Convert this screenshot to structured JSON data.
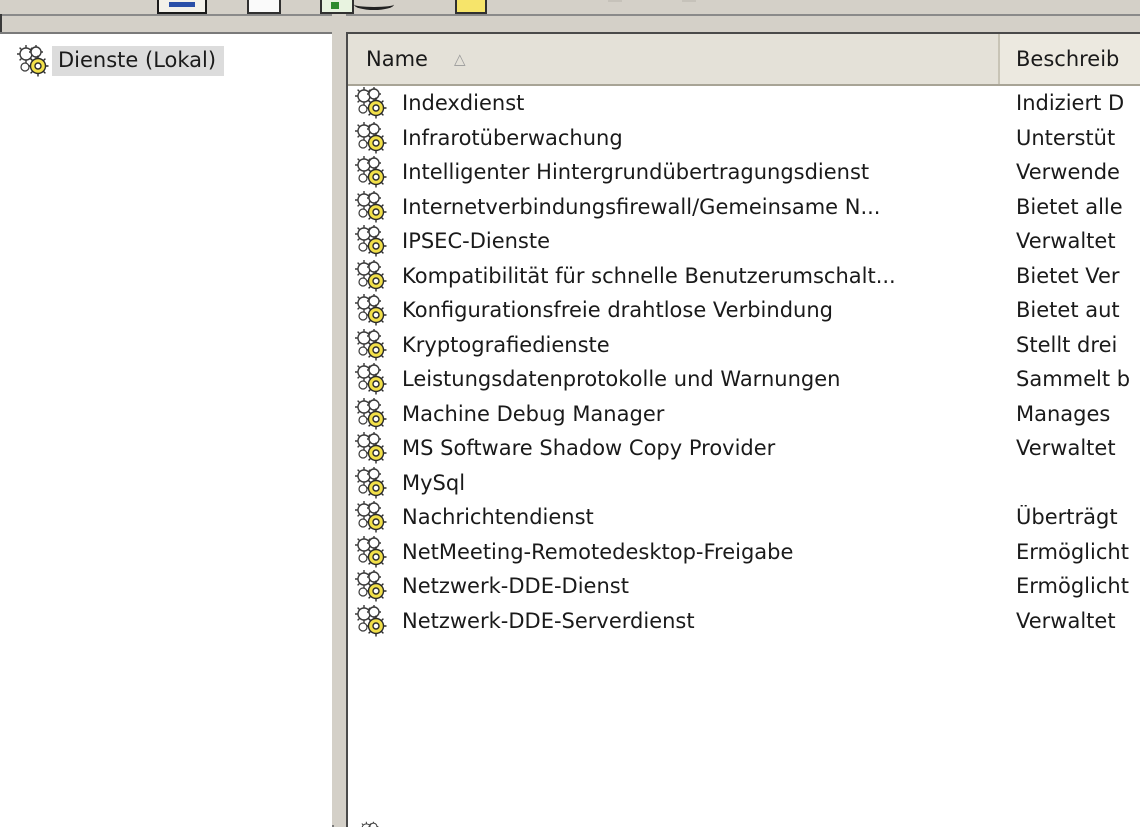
{
  "tree": {
    "root_label": "Dienste (Lokal)",
    "root_icon": "services-gear-icon"
  },
  "list": {
    "columns": {
      "name": "Name",
      "description": "Beschreib"
    },
    "sort_indicator": "ascending",
    "rows": [
      {
        "name": "Indexdienst",
        "description": "Indiziert D"
      },
      {
        "name": "Infrarotüberwachung",
        "description": "Unterstüt"
      },
      {
        "name": "Intelligenter Hintergrundübertragungsdienst",
        "description": "Verwende"
      },
      {
        "name": "Internetverbindungsfirewall/Gemeinsame N...",
        "description": "Bietet alle"
      },
      {
        "name": "IPSEC-Dienste",
        "description": "Verwaltet"
      },
      {
        "name": "Kompatibilität für schnelle Benutzerumschalt...",
        "description": "Bietet Ver"
      },
      {
        "name": "Konfigurationsfreie drahtlose Verbindung",
        "description": "Bietet aut"
      },
      {
        "name": "Kryptografiedienste",
        "description": "Stellt drei"
      },
      {
        "name": "Leistungsdatenprotokolle und Warnungen",
        "description": "Sammelt b"
      },
      {
        "name": "Machine Debug Manager",
        "description": "Manages"
      },
      {
        "name": "MS Software Shadow Copy Provider",
        "description": "Verwaltet"
      },
      {
        "name": "MySql",
        "description": ""
      },
      {
        "name": "Nachrichtendienst",
        "description": "Überträgt"
      },
      {
        "name": "NetMeeting-Remotedesktop-Freigabe",
        "description": "Ermöglicht"
      },
      {
        "name": "Netzwerk-DDE-Dienst",
        "description": "Ermöglicht"
      },
      {
        "name": "Netzwerk-DDE-Serverdienst",
        "description": "Verwaltet"
      }
    ]
  },
  "colors": {
    "window_bg": "#d4d0c8",
    "pane_bg": "#ffffff",
    "header_bg": "#ece9e0",
    "selected_bg": "#dcdcdc",
    "gear_fill": "#f2e04a"
  }
}
